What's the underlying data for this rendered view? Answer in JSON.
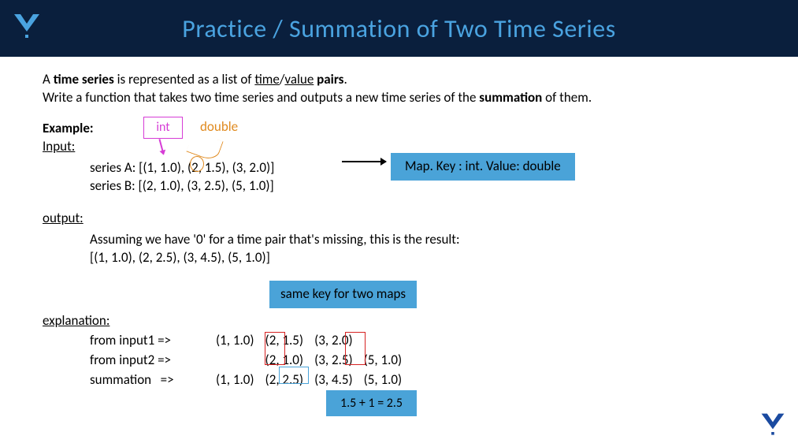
{
  "header": {
    "title": "Practice / Summation of Two Time Series"
  },
  "intro": {
    "line1_prefix": "A ",
    "line1_bold": "time series",
    "line1_mid": " is represented as a list of ",
    "line1_u1": "time",
    "line1_slash": "/",
    "line1_u2": "value",
    "line1_tail": " ",
    "line1_bold2": "pairs",
    "line1_end": ".",
    "line2_a": "Write a function that takes two time series and outputs a new time series of the ",
    "line2_bold": "summation",
    "line2_b": " of them."
  },
  "labels": {
    "example": "Example:",
    "input": "Input:",
    "output": "output:",
    "explanation": "explanation:"
  },
  "annotations": {
    "int": "int",
    "double": "double",
    "map_box": "Map. Key : int. Value: double",
    "same_key": "same key for two maps",
    "sum_formula": "1.5 + 1 = 2.5"
  },
  "input_block": {
    "seriesA": "series A: [(1, 1.0), (2, 1.5), (3, 2.0)]",
    "seriesB": "series B: [(2, 1.0), (3, 2.5), (5, 1.0)]"
  },
  "output_block": {
    "assume": "Assuming we have '0' for a time pair that's missing, this is the result:",
    "result": "[(1, 1.0), (2, 2.5), (3, 4.5), (5, 1.0)]"
  },
  "explanation_rows": {
    "r1_label": "from input1 =>",
    "r2_label": "from input2 =>",
    "r3_label": "summation   =>",
    "col_a": {
      "r1": "(1, 1.0)",
      "r2": "",
      "r3": "(1, 1.0)"
    },
    "col_b": {
      "r1": "(2, 1.5)",
      "r2": "(2, 1.0)",
      "r3": "(2, 2.5)"
    },
    "col_c": {
      "r1": "(3, 2.0)",
      "r2": "(3, 2.5)",
      "r3": "(3, 4.5)"
    },
    "col_d": {
      "r1": "",
      "r2": "(5, 1.0)",
      "r3": "(5, 1.0)"
    }
  }
}
